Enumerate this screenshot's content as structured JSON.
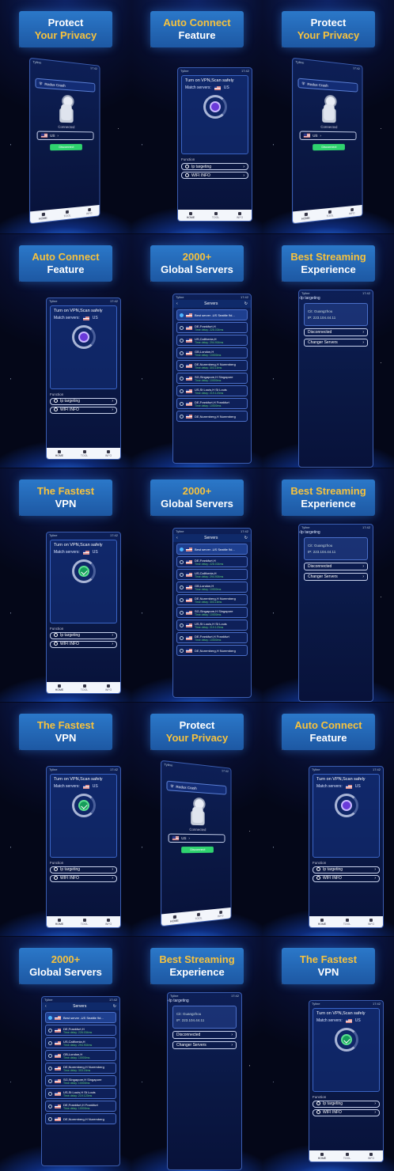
{
  "labels": {
    "privacy": [
      "Protect",
      "Your Privacy"
    ],
    "auto": [
      "Auto Connect",
      "Feature"
    ],
    "global": [
      "2000+",
      "Global Servers"
    ],
    "stream": [
      "Best Streaming",
      "Experience"
    ],
    "fastest": [
      "The Fastest",
      "VPN"
    ]
  },
  "status": {
    "carrier": "Tyline",
    "time": "17:42"
  },
  "nav": [
    "HOME",
    "TOOL",
    "INFO"
  ],
  "home": {
    "title": "Turn on VPN,Scan safely",
    "match_label": "Match servers:",
    "country": "US",
    "function_label": "Function",
    "btn_ip": "Ip targeting",
    "btn_wifi": "WIFI INFO"
  },
  "servers": {
    "title": "Servers",
    "best": "Best server -US Seattle 9d...",
    "list": [
      {
        "name": "DE,Frankfurt,H",
        "delay": "Time delay: 226.034ms"
      },
      {
        "name": "US,California,H",
        "delay": "Time delay: 294.904ms"
      },
      {
        "name": "GB,London,H",
        "delay": "Time delay: 10000ms"
      },
      {
        "name": "DE,Nuremberg,H Nuremberg",
        "delay": "Time delay: 303.16ms"
      },
      {
        "name": "SG,Singapore,H Singapore",
        "delay": "Time delay: 10000ms"
      },
      {
        "name": "US,St Louis,H St Louis",
        "delay": "Time delay: 219.123ms"
      },
      {
        "name": "DE,Frankfurt,H Frankfurt",
        "delay": "Time delay: 10000ms"
      },
      {
        "name": "DE,Nuremberg,H Nuremberg",
        "delay": ""
      }
    ]
  },
  "stream": {
    "title": "Ip targeting",
    "city_label": "Cit:",
    "city": "Guangzhou",
    "ip_label": "IP:",
    "ip": "223.104.44.11",
    "btn_disconnect": "Disconnected",
    "btn_change": "Changer Servers"
  },
  "privacy": {
    "app_name": "Redux Crash",
    "connected": "Connected",
    "country": "US",
    "disconnect": "Disconnect"
  }
}
